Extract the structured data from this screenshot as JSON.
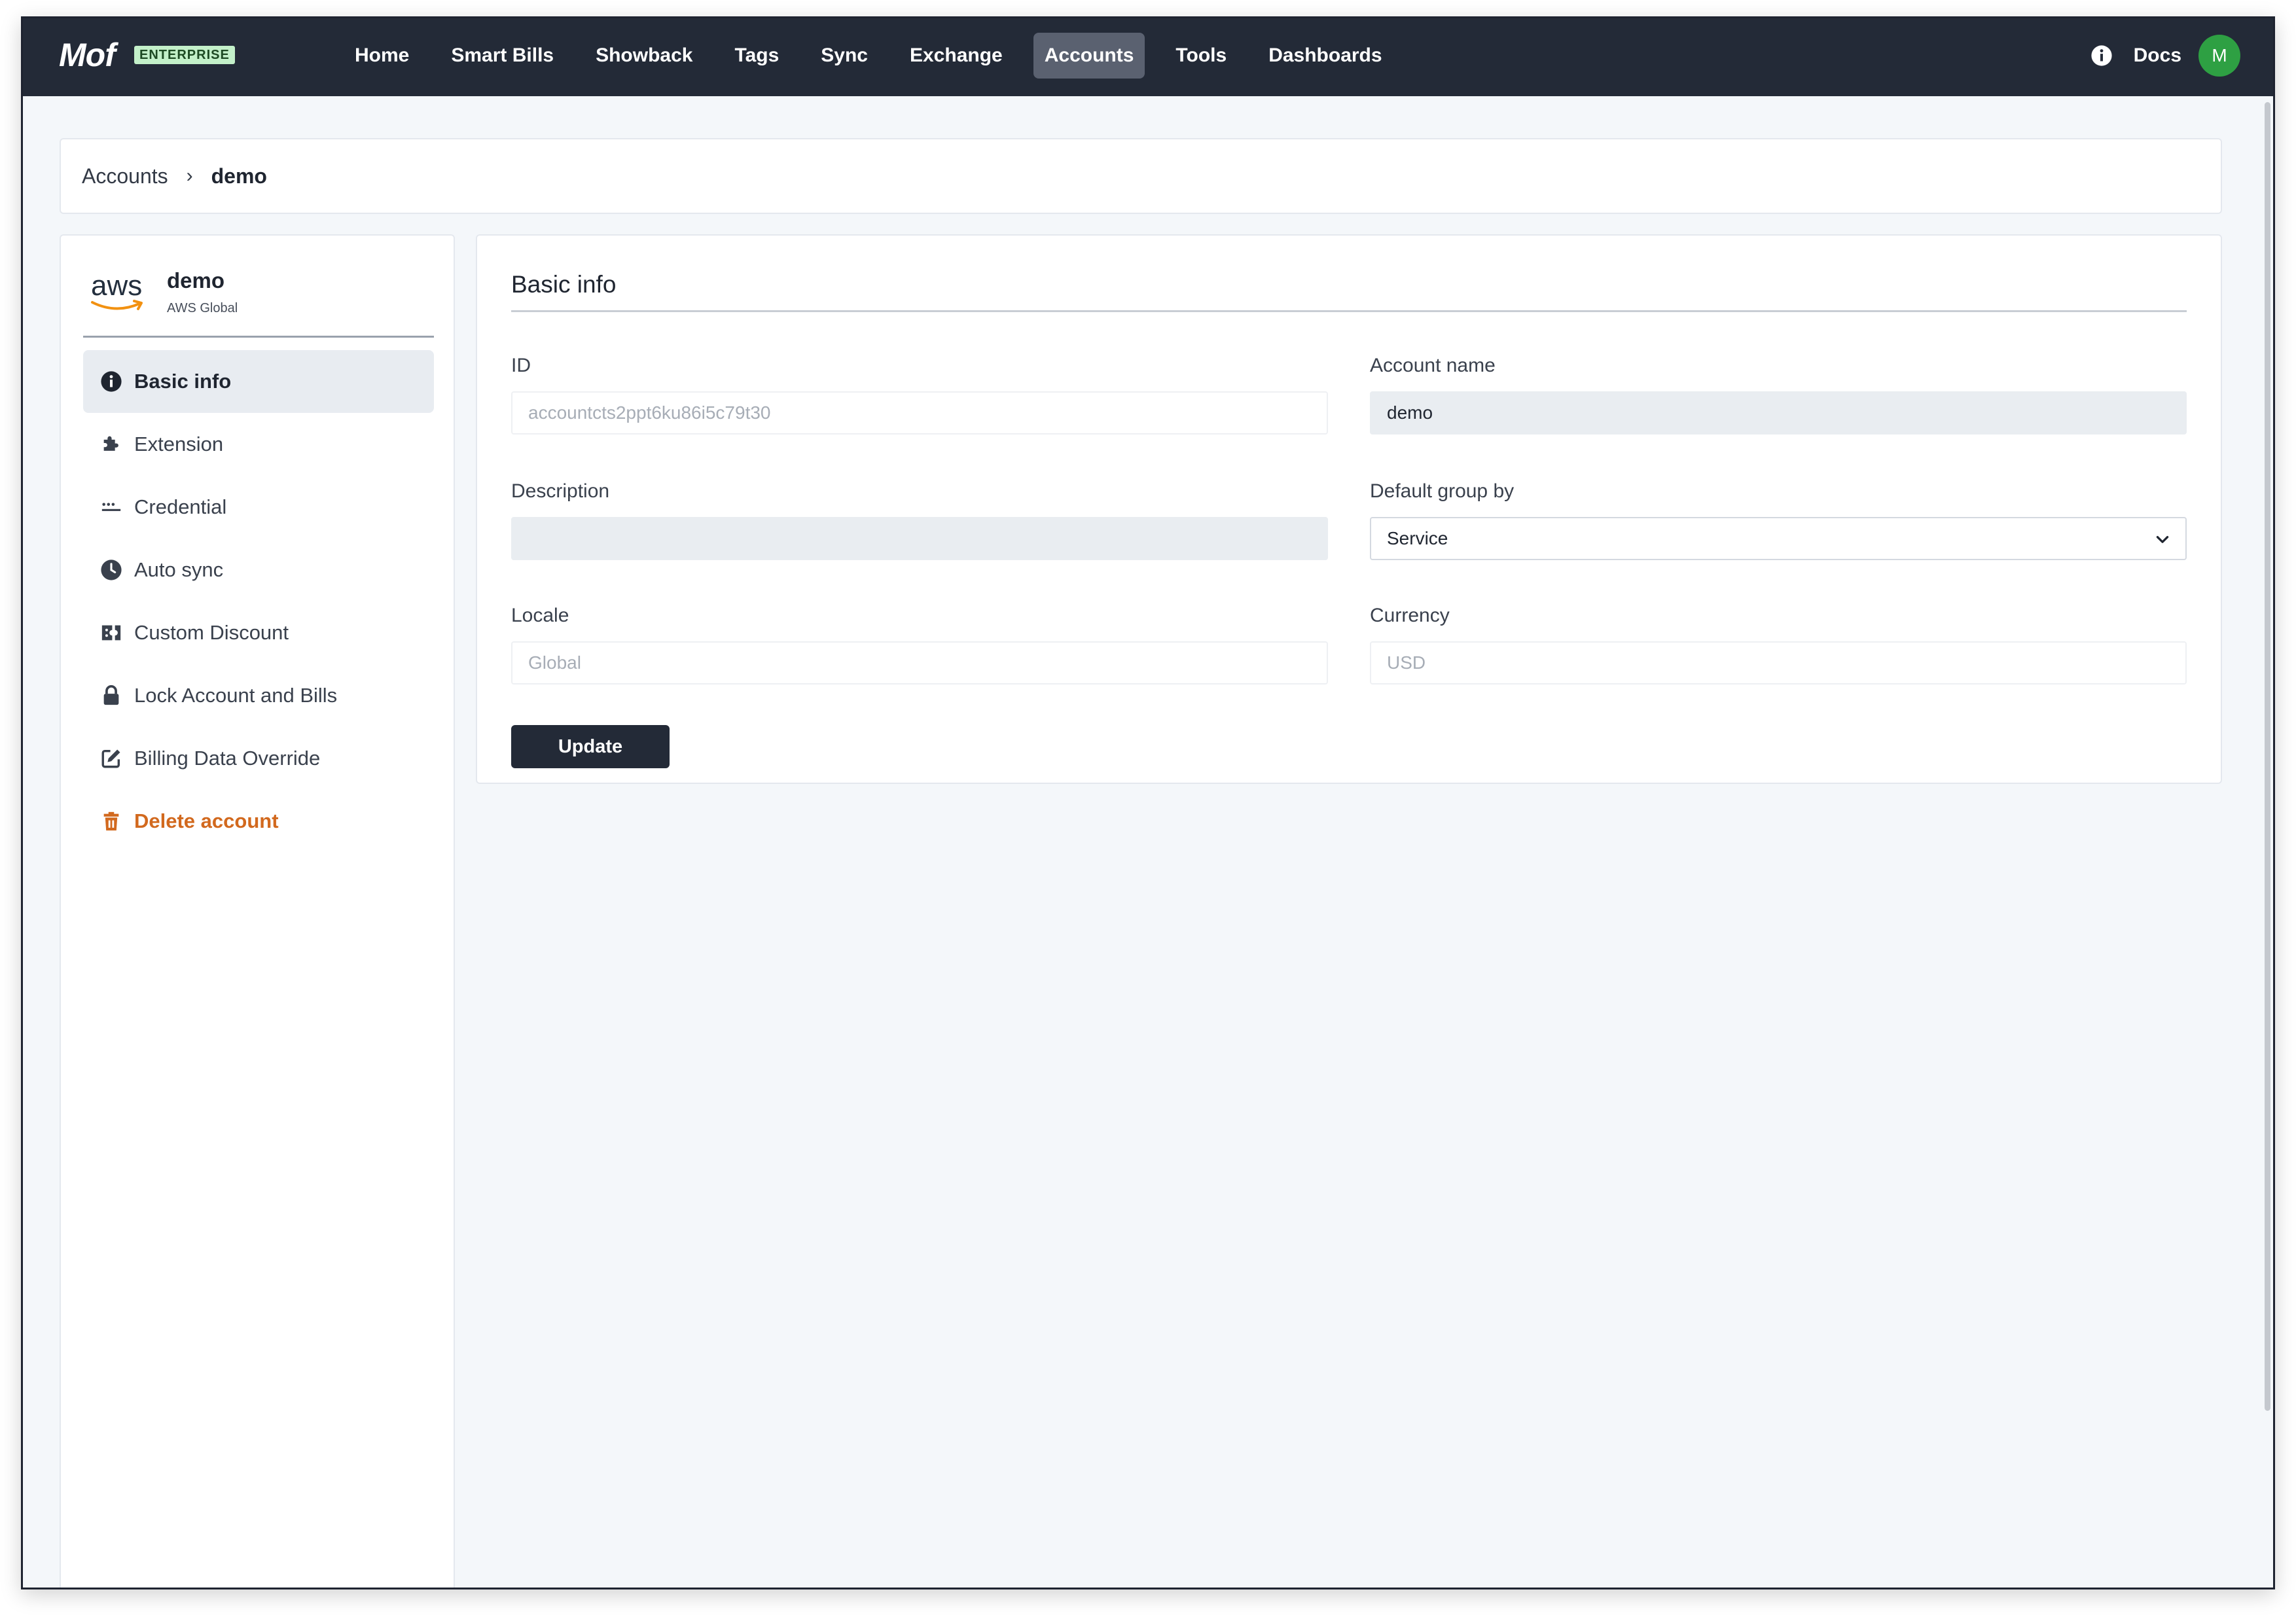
{
  "app": {
    "logo_text": "Mof",
    "edition_badge": "ENTERPRISE"
  },
  "nav": {
    "items": [
      {
        "label": "Home",
        "active": false
      },
      {
        "label": "Smart Bills",
        "active": false
      },
      {
        "label": "Showback",
        "active": false
      },
      {
        "label": "Tags",
        "active": false
      },
      {
        "label": "Sync",
        "active": false
      },
      {
        "label": "Exchange",
        "active": false
      },
      {
        "label": "Accounts",
        "active": true
      },
      {
        "label": "Tools",
        "active": false
      },
      {
        "label": "Dashboards",
        "active": false
      }
    ],
    "docs_label": "Docs",
    "avatar_initial": "M",
    "info_icon": "info-circle-icon"
  },
  "breadcrumb": {
    "root": "Accounts",
    "separator": "›",
    "current": "demo"
  },
  "sidebar": {
    "account": {
      "provider_logo": "aws",
      "name": "demo",
      "region": "AWS Global"
    },
    "items": [
      {
        "label": "Basic info",
        "icon": "info-circle-icon",
        "active": true,
        "danger": false
      },
      {
        "label": "Extension",
        "icon": "puzzle-icon",
        "active": false,
        "danger": false
      },
      {
        "label": "Credential",
        "icon": "password-dots-icon",
        "active": false,
        "danger": false
      },
      {
        "label": "Auto sync",
        "icon": "clock-icon",
        "active": false,
        "danger": false
      },
      {
        "label": "Custom Discount",
        "icon": "ticket-icon",
        "active": false,
        "danger": false
      },
      {
        "label": "Lock Account and Bills",
        "icon": "lock-icon",
        "active": false,
        "danger": false
      },
      {
        "label": "Billing Data Override",
        "icon": "edit-icon",
        "active": false,
        "danger": false
      },
      {
        "label": "Delete account",
        "icon": "trash-icon",
        "active": false,
        "danger": true
      }
    ]
  },
  "form": {
    "title": "Basic info",
    "id": {
      "label": "ID",
      "value": "accountcts2ppt6ku86i5c79t30"
    },
    "account_name": {
      "label": "Account name",
      "value": "demo"
    },
    "description": {
      "label": "Description",
      "value": ""
    },
    "default_group_by": {
      "label": "Default group by",
      "value": "Service"
    },
    "locale": {
      "label": "Locale",
      "value": "Global"
    },
    "currency": {
      "label": "Currency",
      "value": "USD"
    },
    "update_label": "Update"
  },
  "colors": {
    "topnav_bg": "#232a37",
    "active_nav_bg": "#5a6170",
    "badge_bg": "#c3f0c9",
    "avatar_bg": "#2ea043",
    "danger": "#d2691e",
    "page_bg": "#f4f7fa"
  }
}
